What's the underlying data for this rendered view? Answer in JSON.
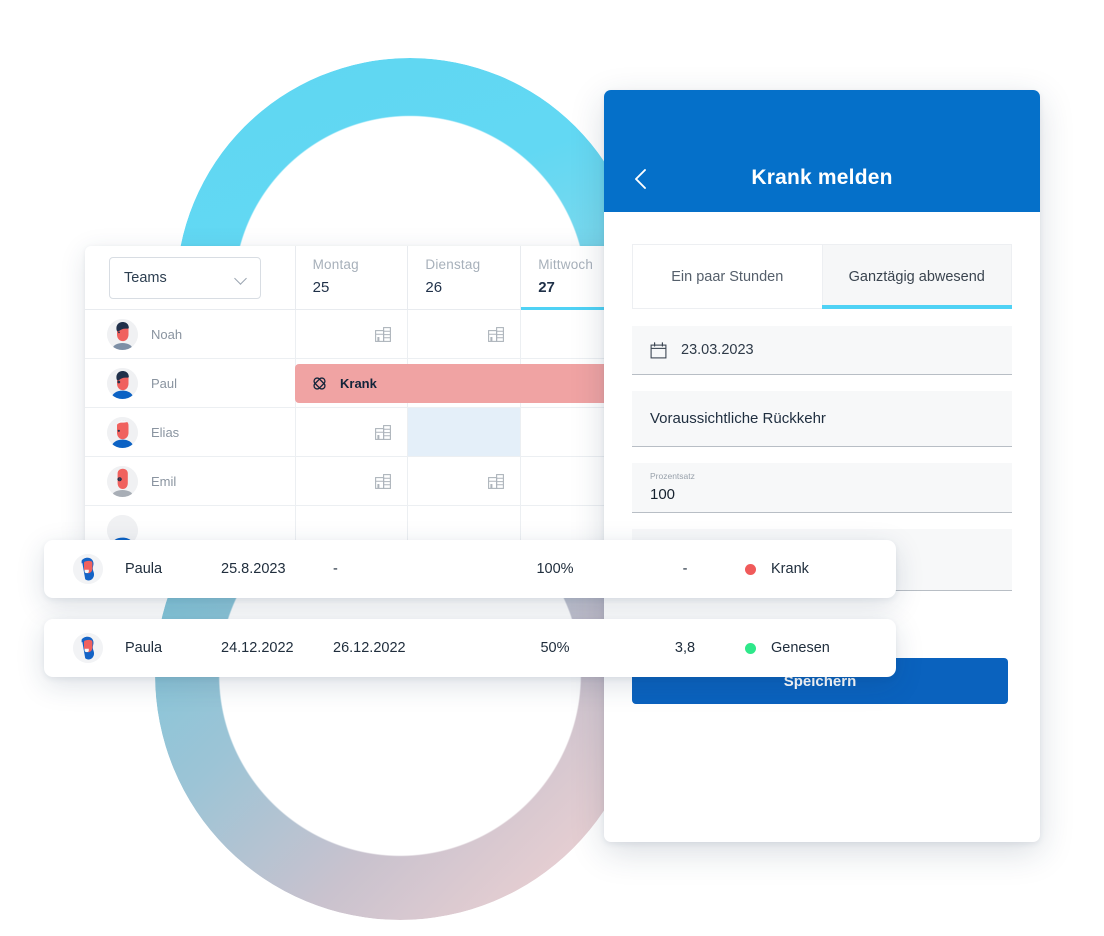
{
  "schedule": {
    "teams_filter": {
      "label": "Teams",
      "icon": "chevron-down-icon"
    },
    "days": [
      {
        "name": "Montag",
        "num": "25",
        "active": false
      },
      {
        "name": "Dienstag",
        "num": "26",
        "active": false
      },
      {
        "name": "Mittwoch",
        "num": "27",
        "active": true
      }
    ],
    "rows": [
      {
        "name": "Noah"
      },
      {
        "name": "Paul"
      },
      {
        "name": "Elias"
      },
      {
        "name": "Emil"
      }
    ],
    "absence_bar": {
      "label": "Krank",
      "icon": "plaster-icon"
    },
    "cell_icon": "office-building-icon"
  },
  "panel": {
    "back_icon": "back-chevron-icon",
    "title": "Krank melden",
    "tabs": [
      {
        "label": "Ein paar Stunden",
        "active": false
      },
      {
        "label": "Ganztägig abwesend",
        "active": true
      }
    ],
    "fields": {
      "date": {
        "icon": "calendar-icon",
        "value": "23.03.2023"
      },
      "return": {
        "value": "Voraussichtliche Rückkehr"
      },
      "percent": {
        "label": "Prozentsatz",
        "value": "100"
      },
      "extra": {
        "value": ""
      }
    },
    "save_label": "Speichern"
  },
  "records": [
    {
      "name": "Paula",
      "from": "25.8.2023",
      "to": "-",
      "percent": "100%",
      "days": "-",
      "status": "Krank",
      "status_color": "#F05A5A"
    },
    {
      "name": "Paula",
      "from": "24.12.2022",
      "to": "26.12.2022",
      "percent": "50%",
      "days": "3,8",
      "status": "Genesen",
      "status_color": "#2EE88A"
    }
  ],
  "colors": {
    "brand_blue": "#0570C9",
    "save_blue": "#0A62BE",
    "cyan_accent": "#4FD2F5",
    "sick_bar": "#F0A3A3",
    "selected_cell": "#E4EFF9"
  }
}
